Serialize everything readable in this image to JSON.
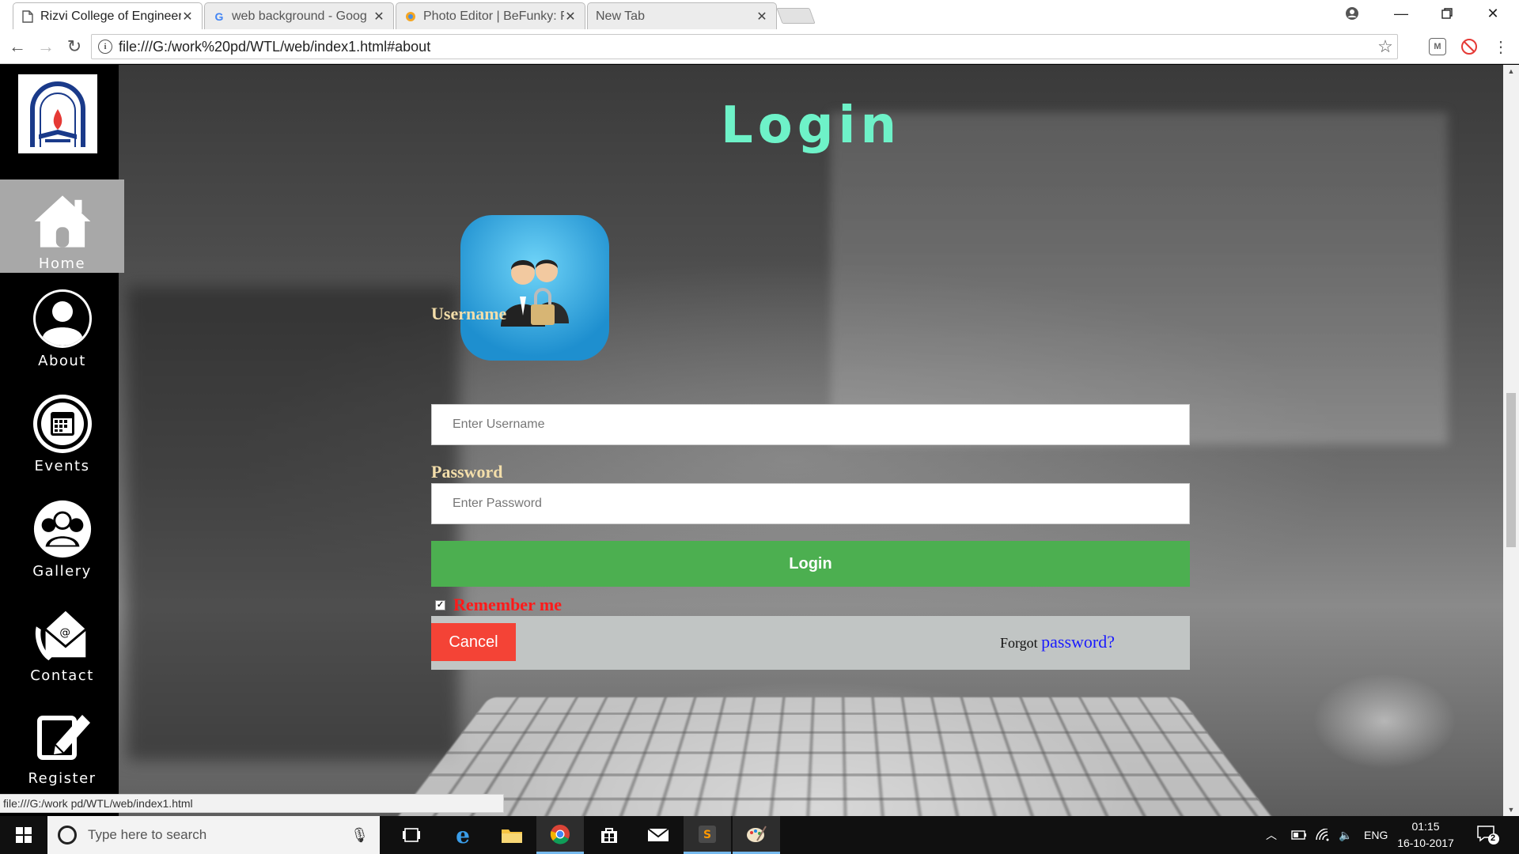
{
  "browser": {
    "tabs": [
      {
        "title": "Rizvi College of Engineer",
        "favicon": "page-icon",
        "active": true
      },
      {
        "title": "web background - Goog",
        "favicon": "google-icon",
        "active": false
      },
      {
        "title": "Photo Editor | BeFunky: F",
        "favicon": "befunky-icon",
        "active": false
      },
      {
        "title": "New Tab",
        "favicon": "",
        "active": false
      }
    ],
    "url": "file:///G:/work%20pd/WTL/web/index1.html#about",
    "status_url": "file:///G:/work pd/WTL/web/index1.html"
  },
  "sidebar": {
    "items": [
      {
        "label": "Home",
        "icon": "home-icon"
      },
      {
        "label": "About",
        "icon": "user-icon"
      },
      {
        "label": "Events",
        "icon": "calendar-icon"
      },
      {
        "label": "Gallery",
        "icon": "group-icon"
      },
      {
        "label": "Contact",
        "icon": "mail-phone-icon"
      },
      {
        "label": "Register",
        "icon": "edit-icon"
      }
    ]
  },
  "login": {
    "title": "Login",
    "username_label": "Username",
    "username_placeholder": "Enter Username",
    "password_label": "Password",
    "password_placeholder": "Enter Password",
    "submit_label": "Login",
    "remember_label": "Remember me",
    "remember_checked": true,
    "cancel_label": "Cancel",
    "forgot_prefix": "Forgot",
    "forgot_link": "password?"
  },
  "taskbar": {
    "search_placeholder": "Type here to search",
    "language": "ENG",
    "time": "01:15",
    "date": "16-10-2017",
    "notification_count": "2"
  },
  "colors": {
    "title": "#6ef2c8",
    "label": "#f3deaa",
    "login_button": "#4caf50",
    "cancel_button": "#f44336",
    "remember": "#ff1a1a",
    "link": "#1a1aff"
  }
}
